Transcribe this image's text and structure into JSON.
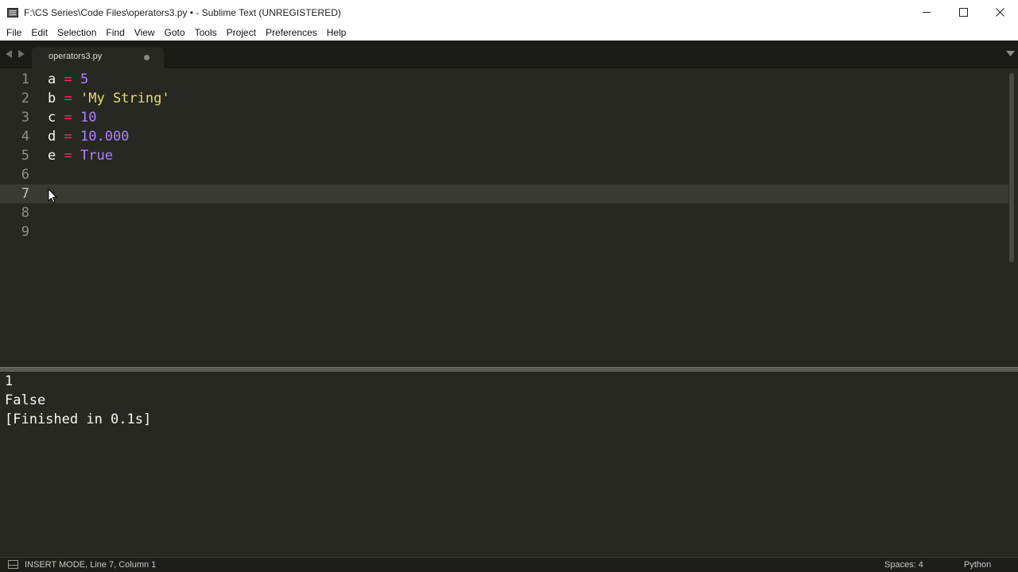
{
  "window": {
    "title": "F:\\CS Series\\Code Files\\operators3.py • - Sublime Text (UNREGISTERED)"
  },
  "menu": [
    {
      "label": "File"
    },
    {
      "label": "Edit"
    },
    {
      "label": "Selection"
    },
    {
      "label": "Find"
    },
    {
      "label": "View"
    },
    {
      "label": "Goto"
    },
    {
      "label": "Tools"
    },
    {
      "label": "Project"
    },
    {
      "label": "Preferences"
    },
    {
      "label": "Help"
    }
  ],
  "tab": {
    "label": "operators3.py",
    "dirty": true
  },
  "editor": {
    "line_numbers": [
      "1",
      "2",
      "3",
      "4",
      "5",
      "6",
      "7",
      "8",
      "9"
    ],
    "active_line": 7,
    "lines": [
      {
        "var": "a",
        "op": "=",
        "value": "5"
      },
      {
        "var": "b",
        "op": "=",
        "value": "'My String'"
      },
      {
        "var": "c",
        "op": "=",
        "value": "10"
      },
      {
        "var": "d",
        "op": "=",
        "value": "10.000"
      },
      {
        "var": "e",
        "op": "=",
        "value": "True"
      }
    ]
  },
  "output": {
    "lines": [
      "1",
      "False",
      "[Finished in 0.1s]"
    ]
  },
  "status": {
    "text": "INSERT MODE, Line 7, Column 1",
    "spaces": "Spaces: 4",
    "syntax": "Python"
  },
  "colors": {
    "background": "#272822",
    "operator": "#f92672",
    "number": "#ae81ff",
    "string": "#e6db74",
    "foreground": "#f8f8f2"
  }
}
